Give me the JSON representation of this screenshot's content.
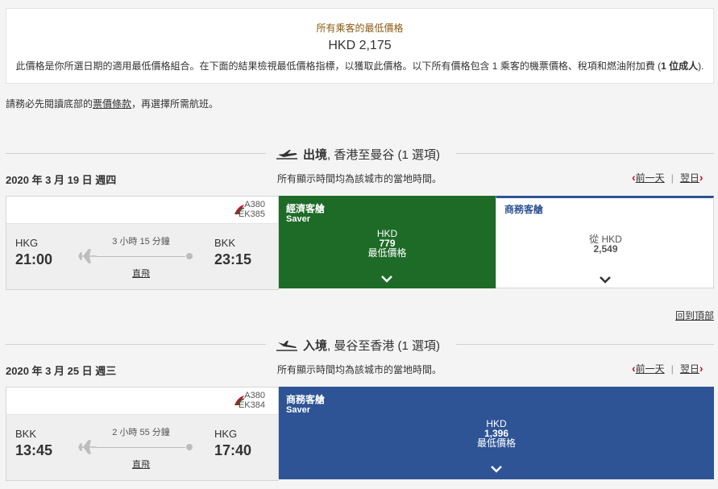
{
  "summary": {
    "label": "所有乘客的最低價格",
    "price": "HKD 2,175",
    "note_main": "此價格是你所選日期的適用最低價格組合。在下面的結果檢視最低價格指標，以獲取此價格。以下所有價格包含 1 乘客的機票價格、稅項和燃油附加費 (",
    "note_bold": "1 位成人",
    "note_end": ")."
  },
  "notice": {
    "before": "請務必先閱讀底部的",
    "link": "票價條款",
    "after": "，再選擇所需航班。"
  },
  "outbound": {
    "direction": "出境",
    "route": ", 香港至曼谷 (1 選項)",
    "date": "2020 年 3 月 19 日 週四",
    "timezone_note": "所有顯示時間均為該城市的當地時間。",
    "prev_day": "前一天",
    "next_day": "翌日",
    "flight": {
      "aircraft": "A380",
      "code": "EK385",
      "from_code": "HKG",
      "from_time": "21:00",
      "duration": "3 小時 15 分鐘",
      "direct": "直飛",
      "to_code": "BKK",
      "to_time": "23:15"
    },
    "fares": [
      {
        "cabin": "經濟客艙",
        "sub": "Saver",
        "currency": "HKD",
        "amount": "779",
        "tag": "最低價格"
      },
      {
        "cabin": "商務客艙",
        "prefix": "從 HKD",
        "amount": "2,549"
      }
    ]
  },
  "back_to_top": "回到頂部",
  "inbound": {
    "direction": "入境",
    "route": ", 曼谷至香港 (1 選項)",
    "date": "2020 年 3 月 25 日 週三",
    "timezone_note": "所有顯示時間均為該城市的當地時間。",
    "prev_day": "前一天",
    "next_day": "翌日",
    "flight": {
      "aircraft": "A380",
      "code": "EK384",
      "from_code": "BKK",
      "from_time": "13:45",
      "duration": "2 小時 55 分鐘",
      "direct": "直飛",
      "to_code": "HKG",
      "to_time": "17:40"
    },
    "fares": [
      {
        "cabin": "商務客艙",
        "sub": "Saver",
        "currency": "HKD",
        "amount": "1,396",
        "tag": "最低價格"
      }
    ]
  },
  "colors": {
    "economy_green": "#1e6b28",
    "business_blue": "#2e5496",
    "accent_red": "#c8102e"
  },
  "icons": [
    "plane-takeoff-icon",
    "plane-landing-icon",
    "plane-icon",
    "emirates-logo-icon",
    "chevron-left-icon",
    "chevron-right-icon",
    "chevron-down-icon"
  ]
}
